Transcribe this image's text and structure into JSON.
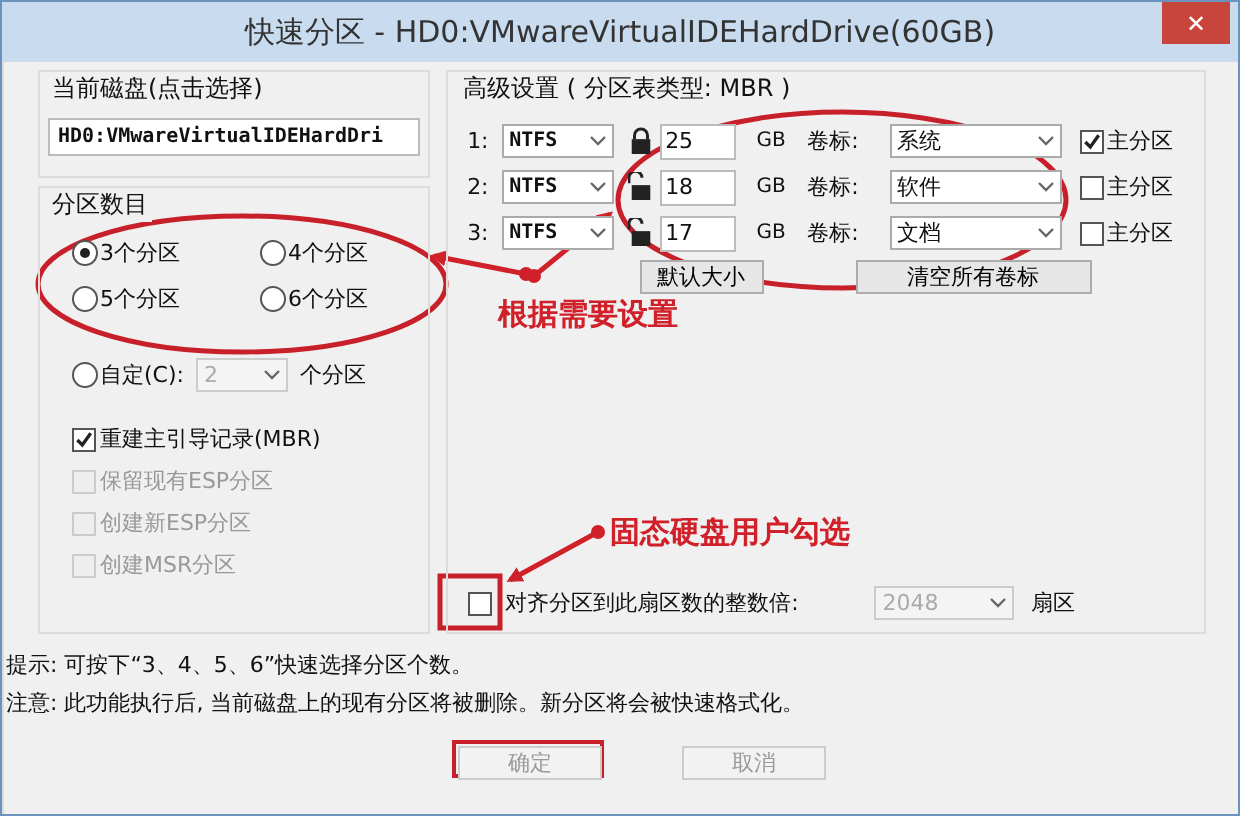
{
  "window": {
    "title": "快速分区 - HD0:VMwareVirtualIDEHardDrive(60GB)",
    "close": "✕"
  },
  "current_disk": {
    "label": "当前磁盘(点击选择)",
    "value": "HD0:VMwareVirtualIDEHardDri"
  },
  "partition_count": {
    "label": "分区数目",
    "options": [
      {
        "label": "3个分区",
        "selected": true
      },
      {
        "label": "4个分区",
        "selected": false
      },
      {
        "label": "5个分区",
        "selected": false
      },
      {
        "label": "6个分区",
        "selected": false
      }
    ],
    "custom": {
      "label": "自定(C):",
      "selected": false,
      "value": "2",
      "unit": "个分区",
      "disabled": true
    }
  },
  "options": [
    {
      "label": "重建主引导记录(MBR)",
      "checked": true,
      "disabled": false
    },
    {
      "label": "保留现有ESP分区",
      "checked": false,
      "disabled": true
    },
    {
      "label": "创建新ESP分区",
      "checked": false,
      "disabled": true
    },
    {
      "label": "创建MSR分区",
      "checked": false,
      "disabled": true
    }
  ],
  "advanced": {
    "label": "高级设置 ( 分区表类型: MBR )",
    "partitions": [
      {
        "index": "1:",
        "fs": "NTFS",
        "locked": true,
        "size": "25",
        "unit": "GB",
        "volume_label": "卷标:",
        "volume": "系统",
        "primary_label": "主分区",
        "primary": true
      },
      {
        "index": "2:",
        "fs": "NTFS",
        "locked": false,
        "size": "18",
        "unit": "GB",
        "volume_label": "卷标:",
        "volume": "软件",
        "primary_label": "主分区",
        "primary": false
      },
      {
        "index": "3:",
        "fs": "NTFS",
        "locked": false,
        "size": "17",
        "unit": "GB",
        "volume_label": "卷标:",
        "volume": "文档",
        "primary_label": "主分区",
        "primary": false
      }
    ],
    "buttons": [
      "默认大小",
      "清空所有卷标"
    ],
    "align": {
      "label": "对齐分区到此扇区数的整数倍:",
      "checked": false,
      "value": "2048",
      "unit": "扇区"
    }
  },
  "hints": [
    "提示: 可按下“3、4、5、6”快速选择分区个数。",
    "注意: 此功能执行后, 当前磁盘上的现有分区将被删除。新分区将会被快速格式化。"
  ],
  "buttons": [
    {
      "label": "确定",
      "disabled": true
    },
    {
      "label": "取消",
      "disabled": true
    }
  ],
  "annotations": [
    {
      "text": "根据需要设置"
    },
    {
      "text": "固态硬盘用户勾选"
    }
  ]
}
